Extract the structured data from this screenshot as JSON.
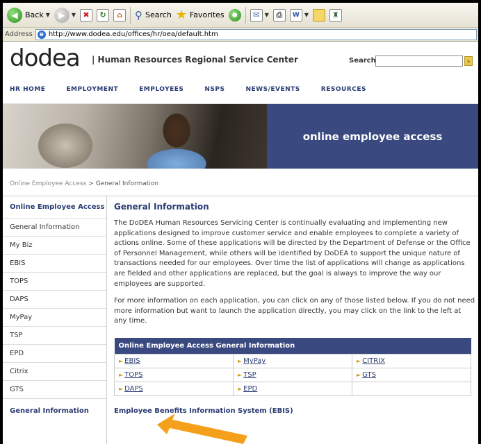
{
  "browser": {
    "back_label": "Back",
    "search_label": "Search",
    "favorites_label": "Favorites",
    "address_label": "Address",
    "url": "http://www.dodea.edu/offices/hr/oea/default.htm"
  },
  "header": {
    "logo": "dodea",
    "site_title": "| Human Resources Regional Service Center",
    "search_label": "Search"
  },
  "nav": [
    "HR HOME",
    "EMPLOYMENT",
    "EMPLOYEES",
    "NSPS",
    "NEWS/EVENTS",
    "RESOURCES"
  ],
  "banner": {
    "text": "online employee access"
  },
  "breadcrumb": {
    "parent": "Online Employee Access",
    "separator": ">",
    "current": "General Information"
  },
  "sidebar": {
    "heading": "Online Employee Access",
    "items": [
      "General Information",
      "My Biz",
      "EBIS",
      "TOPS",
      "DAPS",
      "MyPay",
      "TSP",
      "EPD",
      "Citrix",
      "GTS"
    ],
    "footer_heading": "General Information"
  },
  "main": {
    "title": "General Information",
    "paragraph1": "The DoDEA Human Resources Servicing Center is continually evaluating and implementing new applications designed to improve customer service and enable employees to complete a variety of actions online. Some of these applications will be directed by the Department of Defense or the Office of Personnel Management, while others will be identified by DoDEA to support the unique nature of transactions needed for our employees. Over time the list of applications will change as applications are fielded and other applications are replaced, but the goal is always to improve the way our employees are supported.",
    "paragraph2": "For more information on each application, you can click on any of those listed below. If you do not need more information but want to launch the application directly, you may click on the link to the left at any time.",
    "table": {
      "header": "Online Employee Access General Information",
      "rows": [
        [
          "EBIS",
          "MyPay",
          "CITRIX"
        ],
        [
          "TOPS",
          "TSP",
          "GTS"
        ],
        [
          "DAPS",
          "EPD",
          ""
        ]
      ]
    },
    "next_heading": "Employee Benefits Information System (EBIS)"
  },
  "annotation": {
    "color": "#f5a01a"
  }
}
